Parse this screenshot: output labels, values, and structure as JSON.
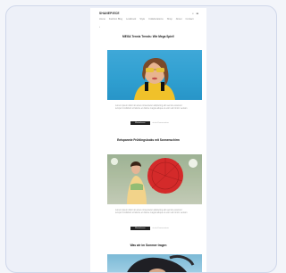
{
  "site": {
    "title": "SHANEPIECE",
    "header_icons": "⌕ ☰",
    "nav": [
      "Home",
      "Fashion Blog",
      "Lookbook",
      "Style",
      "Collaborations",
      "Shop",
      "About",
      "Contact"
    ]
  },
  "posts": [
    {
      "title": "MEGA Tennis Trends: Wie Mega Spiel!",
      "excerpt": "Lorem ipsum dolor sit amet consectetur adipiscing elit sed do eiusmod tempor incididunt ut labore et dolore magna aliqua ut enim ad minim veniam",
      "button": "Weiterlesen",
      "meta": "● ● ● Kommentare"
    },
    {
      "title": "Entspannte Frühlingslooks mit Sonnenschirm",
      "excerpt": "Lorem ipsum dolor sit amet consectetur adipiscing elit sed do eiusmod tempor incididunt ut labore et dolore magna aliqua ut enim ad minim veniam",
      "button": "Weiterlesen",
      "meta": "● ● ● Kommentare"
    },
    {
      "title": "Was wir im Sommer tragen",
      "excerpt": "",
      "button": "",
      "meta": ""
    }
  ],
  "colors": {
    "page_bg": "#f3f5fa",
    "card_bg": "#edf0f8",
    "card_border": "#cfd7ea",
    "accent_dark": "#222222"
  }
}
